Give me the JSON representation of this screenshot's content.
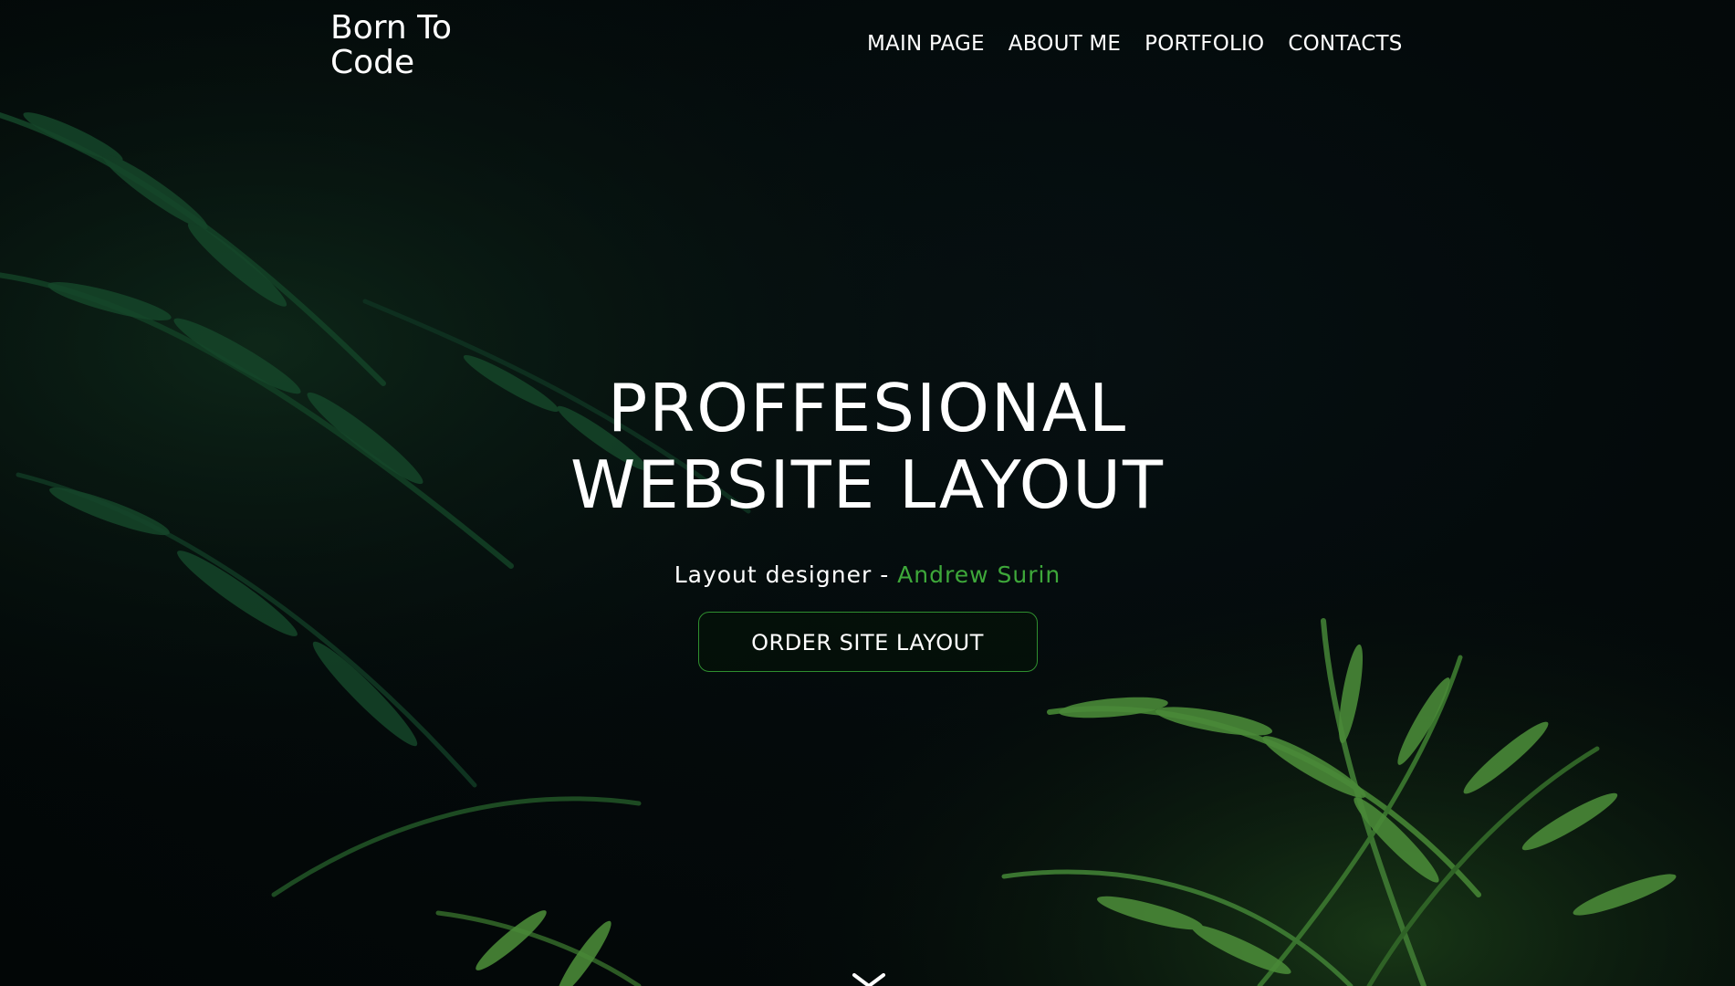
{
  "header": {
    "logo_line1": "Born To",
    "logo_line2": "Code",
    "nav": [
      {
        "label": "MAIN PAGE"
      },
      {
        "label": "ABOUT ME"
      },
      {
        "label": "PORTFOLIO"
      },
      {
        "label": "CONTACTS"
      }
    ]
  },
  "hero": {
    "title_line1": "PROFFESIONAL",
    "title_line2": "WEBSITE LAYOUT",
    "subtitle_prefix": "Layout designer - ",
    "subtitle_name": "Andrew Surin",
    "cta_label": "ORDER SITE LAYOUT"
  },
  "icons": {
    "scroll": "chevron-down-icon"
  },
  "colors": {
    "accent": "#3ea83a",
    "background": "#03090a",
    "button_border": "#2f8f2f"
  }
}
